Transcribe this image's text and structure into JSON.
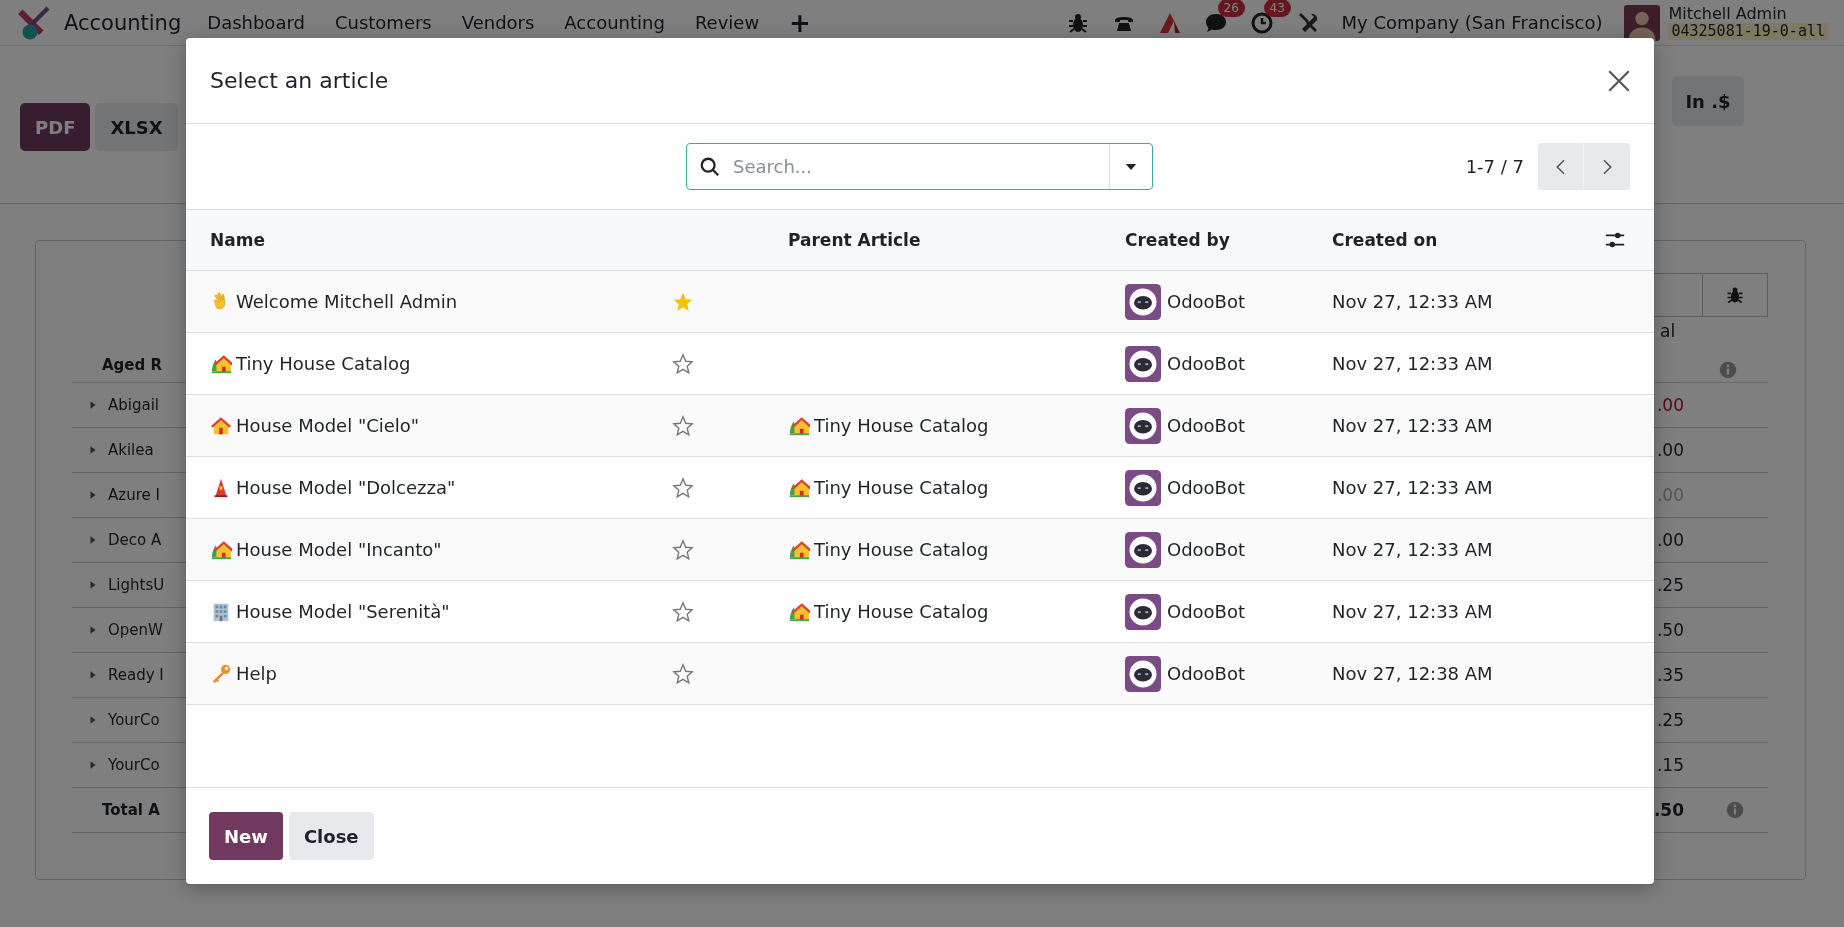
{
  "navbar": {
    "app_name": "Accounting",
    "menu": [
      "Dashboard",
      "Customers",
      "Vendors",
      "Accounting",
      "Review"
    ],
    "add_label": "+",
    "systray": [
      {
        "kind": "bug"
      },
      {
        "kind": "phone"
      },
      {
        "kind": "ai"
      },
      {
        "kind": "chat",
        "badge": "26"
      },
      {
        "kind": "clock",
        "badge": "43"
      },
      {
        "kind": "tools"
      }
    ],
    "company": "My Company (San Francisco)",
    "user": "Mitchell Admin",
    "database": "04325081-19-0-all"
  },
  "report": {
    "export_buttons": [
      {
        "label": "PDF",
        "primary": true
      },
      {
        "label": "XLSX",
        "primary": false
      }
    ],
    "currency_button": "In .$",
    "title": "Aged R",
    "column_header": "al",
    "rows": [
      {
        "name": "Abigail",
        "amount": ".00",
        "negative": true,
        "greyed": false
      },
      {
        "name": "Akilea",
        "amount": ".00",
        "negative": false,
        "greyed": false
      },
      {
        "name": "Azure I",
        "amount": ".00",
        "negative": false,
        "greyed": true
      },
      {
        "name": "Deco A",
        "amount": ".00",
        "negative": false,
        "greyed": false
      },
      {
        "name": "LightsU",
        "amount": ".25",
        "negative": false,
        "greyed": false
      },
      {
        "name": "OpenW",
        "amount": ".50",
        "negative": false,
        "greyed": false
      },
      {
        "name": "Ready I",
        "amount": ".35",
        "negative": false,
        "greyed": false
      },
      {
        "name": "YourCo",
        "amount": ".25",
        "negative": false,
        "greyed": false
      },
      {
        "name": "YourCo",
        "amount": ".15",
        "negative": false,
        "greyed": false
      }
    ],
    "total_label": "Total A",
    "total_amount": ".50"
  },
  "dialog": {
    "title": "Select an article",
    "search": {
      "placeholder": "Search..."
    },
    "pager": "1-7 / 7",
    "columns": [
      "Name",
      "Parent Article",
      "Created by",
      "Created on"
    ],
    "rows": [
      {
        "kind": "wave",
        "name": "Welcome Mitchell Admin",
        "favorite": true,
        "created_by": "OdooBot",
        "created_on": "Nov 27, 12:33 AM"
      },
      {
        "kind": "garden-house",
        "name": "Tiny House Catalog",
        "favorite": false,
        "created_by": "OdooBot",
        "created_on": "Nov 27, 12:33 AM"
      },
      {
        "kind": "house",
        "name": "House Model \"Cielo\"",
        "favorite": false,
        "parent": {
          "kind": "garden-house",
          "name": "Tiny House Catalog"
        },
        "created_by": "OdooBot",
        "created_on": "Nov 27, 12:33 AM"
      },
      {
        "kind": "tower",
        "name": "House Model \"Dolcezza\"",
        "favorite": false,
        "parent": {
          "kind": "garden-house",
          "name": "Tiny House Catalog"
        },
        "created_by": "OdooBot",
        "created_on": "Nov 27, 12:33 AM"
      },
      {
        "kind": "garden-house",
        "name": "House Model \"Incanto\"",
        "favorite": false,
        "parent": {
          "kind": "garden-house",
          "name": "Tiny House Catalog"
        },
        "created_by": "OdooBot",
        "created_on": "Nov 27, 12:33 AM"
      },
      {
        "kind": "office",
        "name": "House Model \"Serenità\"",
        "favorite": false,
        "parent": {
          "kind": "garden-house",
          "name": "Tiny House Catalog"
        },
        "created_by": "OdooBot",
        "created_on": "Nov 27, 12:33 AM"
      },
      {
        "kind": "key",
        "name": "Help",
        "favorite": false,
        "created_by": "OdooBot",
        "created_on": "Nov 27, 12:38 AM"
      }
    ],
    "buttons": [
      {
        "label": "New",
        "primary": true
      },
      {
        "label": "Close",
        "primary": false
      }
    ]
  }
}
